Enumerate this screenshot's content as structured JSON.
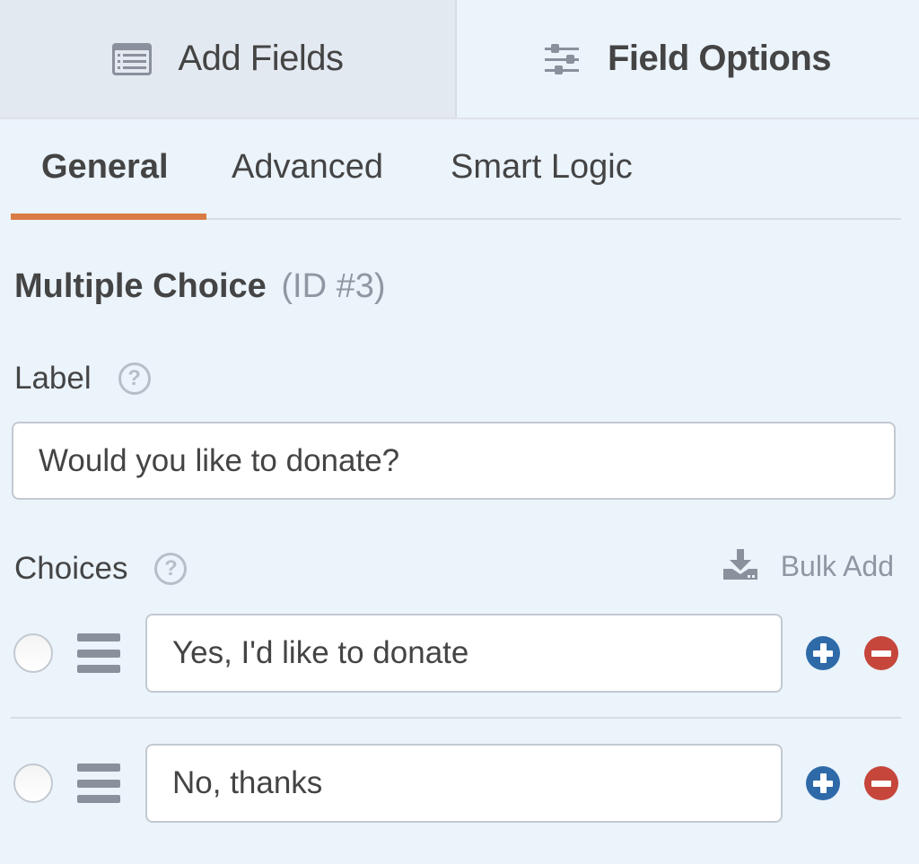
{
  "top_tabs": {
    "add_fields": {
      "label": "Add Fields",
      "icon": "list-icon"
    },
    "field_options": {
      "label": "Field Options",
      "icon": "sliders-icon",
      "active": true
    }
  },
  "sub_tabs": [
    {
      "label": "General",
      "active": true
    },
    {
      "label": "Advanced"
    },
    {
      "label": "Smart Logic"
    }
  ],
  "colors": {
    "active_tab_underline": "#d97b43",
    "add_choice": "#2e6aa8",
    "remove_choice": "#c6463b",
    "background": "#ebf3fb"
  },
  "field": {
    "type": "Multiple Choice",
    "id_label": "(ID #3)"
  },
  "label_field": {
    "label": "Label",
    "help_icon": "question-circle-icon",
    "value": "Would you like to donate?"
  },
  "choices": {
    "label": "Choices",
    "help_icon": "question-circle-icon",
    "bulk_add_label": "Bulk Add",
    "bulk_add_icon": "download-icon",
    "items": [
      {
        "value": "Yes, I'd like to donate",
        "selected": false
      },
      {
        "value": "No, thanks",
        "selected": false
      }
    ]
  }
}
